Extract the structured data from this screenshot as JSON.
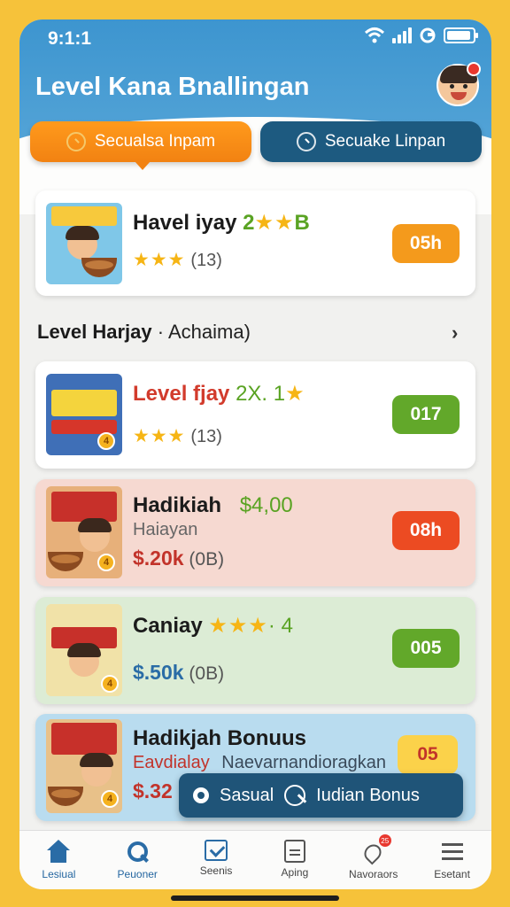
{
  "status": {
    "time": "9:1:1"
  },
  "header": {
    "title": "Level Kana Bnallingan"
  },
  "tabs": [
    {
      "label": "Secualsa Inpam"
    },
    {
      "label": "Secuake Linpan"
    }
  ],
  "featured": {
    "title": "Havel iyay",
    "title_suffix": "2",
    "title_stars": "★★",
    "title_tail": "B",
    "stars": "★★★",
    "count": "(13)",
    "badge": "05h"
  },
  "section": {
    "title": "Level Harjay",
    "subtitle": "· Achaima)"
  },
  "items": [
    {
      "title": "Level fjay",
      "rating_text": "2X. 1",
      "title_star": "★",
      "stars": "★★★",
      "count": "(13)",
      "badge": "017",
      "thumb_coin": "4"
    },
    {
      "title": "Hadikiah",
      "price": "$4,00",
      "subtitle": "Haiayan",
      "amount": "$.20k",
      "amount_note": "(0B)",
      "badge": "08h",
      "thumb_coin": "4"
    },
    {
      "title": "Caniay",
      "stars": "★★★",
      "rating_suffix": "· 4",
      "amount": "$.50k",
      "amount_note": "(0B)",
      "badge": "005",
      "thumb_coin": "4"
    },
    {
      "title": "Hadikjah Bonuus",
      "subtitle_a": "Eavdialay",
      "subtitle_b": "Naevarnandioragkan",
      "amount": "$.32",
      "badge": "05",
      "thumb_coin": "4"
    }
  ],
  "floating_button": {
    "label_a": "Sasual",
    "label_b": "Iudian Bonus"
  },
  "bottom_nav": [
    {
      "label": "Lesiual",
      "icon": "home-icon"
    },
    {
      "label": "Peuoner",
      "icon": "search-icon"
    },
    {
      "label": "Seenis",
      "icon": "checklist-icon"
    },
    {
      "label": "Aping",
      "icon": "document-icon"
    },
    {
      "label": "Navoraors",
      "icon": "tag-icon",
      "badge": "25"
    },
    {
      "label": "Esetant",
      "icon": "menu-icon"
    }
  ],
  "colors": {
    "background": "#f6c23a",
    "header_blue": "#3d95cf",
    "orange_tab": "#f28212",
    "navy_tab": "#1d5a80",
    "badge_orange": "#f49a1c",
    "badge_green": "#62a82a",
    "badge_red": "#ec4b22",
    "badge_yellow": "#fbd24a"
  }
}
